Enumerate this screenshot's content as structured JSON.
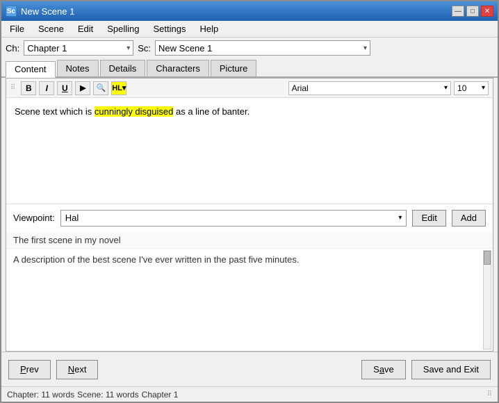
{
  "window": {
    "title": "New Scene 1",
    "icon_label": "Sc"
  },
  "titlebar_controls": {
    "minimize": "—",
    "maximize": "□",
    "close": "✕"
  },
  "menubar": {
    "items": [
      "File",
      "Scene",
      "Edit",
      "Spelling",
      "Settings",
      "Help"
    ]
  },
  "toolbar": {
    "chapter_label": "Ch:",
    "chapter_value": "Chapter 1",
    "scene_label": "Sc:",
    "scene_value": "New Scene 1"
  },
  "tabs": {
    "items": [
      "Content",
      "Notes",
      "Details",
      "Characters",
      "Picture"
    ],
    "active": "Content"
  },
  "format_bar": {
    "bold": "B",
    "italic": "I",
    "underline": "U",
    "play": "▶",
    "search": "🔍",
    "highlight": "HL▾",
    "font_family": "Arial",
    "font_size": "10"
  },
  "editor": {
    "text_before": "Scene text which is ",
    "text_highlighted": "cunningly disguised",
    "text_after": " as a line of banter."
  },
  "viewpoint": {
    "label": "Viewpoint:",
    "value": "Hal",
    "edit_btn": "Edit",
    "add_btn": "Add"
  },
  "scene_info": {
    "title": "The first scene in my novel",
    "description": "A description of the best scene I've ever written in the past five minutes."
  },
  "bottom": {
    "prev_label": "Prev",
    "next_label": "Next",
    "save_label": "Save",
    "save_exit_label": "Save and Exit"
  },
  "statusbar": {
    "chapter_words": "Chapter: 11 words",
    "scene_words": "Scene: 11 words",
    "chapter_name": "Chapter 1"
  }
}
